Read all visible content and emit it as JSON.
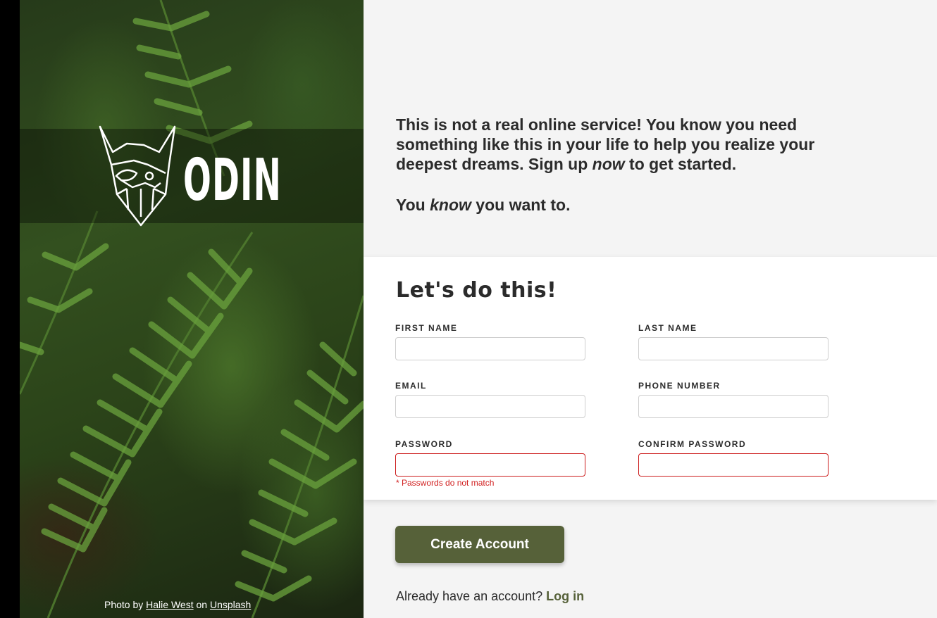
{
  "brand": {
    "name": "ODIN"
  },
  "hero": {
    "credit_prefix": "Photo by",
    "credit_author": "Halie West",
    "credit_mid": "on",
    "credit_site": "Unsplash"
  },
  "intro": {
    "line1_a": "This is not a real online service! You know you need something like this in your life to help you realize your deepest dreams. Sign up ",
    "line1_em": "now",
    "line1_b": " to get started.",
    "line2_a": "You ",
    "line2_em": "know",
    "line2_b": " you want to."
  },
  "form": {
    "title": "Let's do this!",
    "fields": {
      "first_name": {
        "label": "FIRST NAME",
        "value": ""
      },
      "last_name": {
        "label": "LAST NAME",
        "value": ""
      },
      "email": {
        "label": "EMAIL",
        "value": ""
      },
      "phone": {
        "label": "PHONE NUMBER",
        "value": ""
      },
      "password": {
        "label": "PASSWORD",
        "value": ""
      },
      "confirm_password": {
        "label": "CONFIRM PASSWORD",
        "value": ""
      }
    },
    "error": "* Passwords do not match"
  },
  "actions": {
    "create_label": "Create Account",
    "login_prompt": "Already have an account?",
    "login_label": "Log in"
  },
  "colors": {
    "accent": "#566139",
    "error": "#cc1d1d",
    "text": "#2b2b2b",
    "background": "#f4f4f4"
  }
}
